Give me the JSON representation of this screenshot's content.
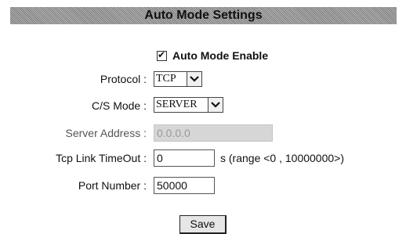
{
  "header": {
    "title": "Auto Mode Settings"
  },
  "auto_mode": {
    "enable_label": "Auto Mode Enable",
    "enabled": true
  },
  "form": {
    "protocol": {
      "label": "Protocol :",
      "value": "TCP"
    },
    "cs_mode": {
      "label": "C/S Mode :",
      "value": "SERVER"
    },
    "server_address": {
      "label": "Server Address :",
      "value": "0.0.0.0",
      "disabled": true
    },
    "tcp_link_timeout": {
      "label": "Tcp Link TimeOut :",
      "value": "0",
      "hint": "s (range <0 , 10000000>)"
    },
    "port_number": {
      "label": "Port Number :",
      "value": "50000"
    }
  },
  "actions": {
    "save_label": "Save"
  },
  "icons": {
    "check": "checkmark-icon",
    "dropdown": "chevron-down-icon"
  },
  "colors": {
    "title_bar": "#9a9a9a",
    "disabled_field": "#d6d6d6",
    "disabled_text": "#9a9a9a",
    "button_face": "#e6e6e6"
  }
}
